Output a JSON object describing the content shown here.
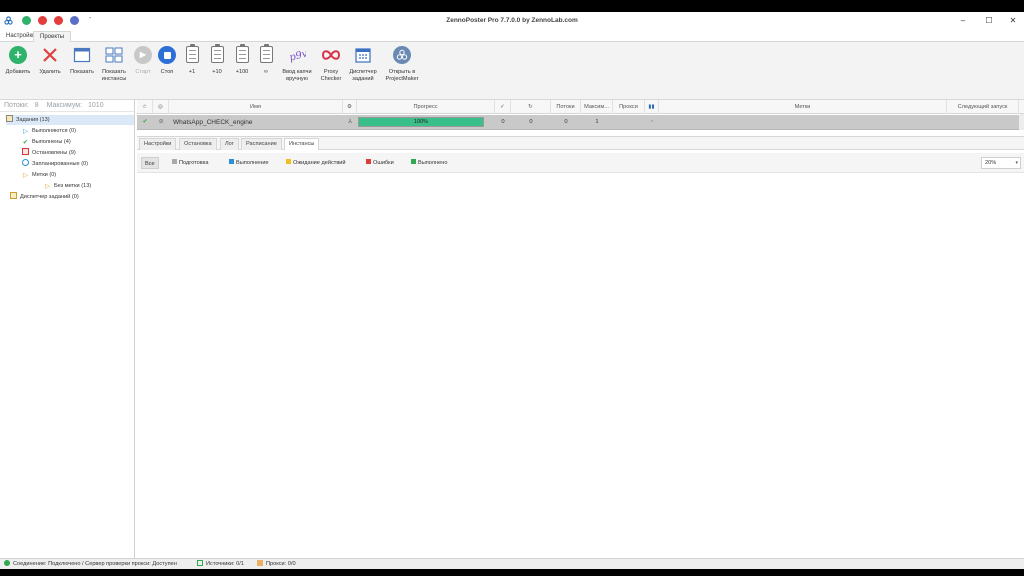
{
  "window": {
    "title": "ZennoPoster Pro 7.7.0.0 by ZennoLab.com",
    "qat_more": "-",
    "minimize": "–",
    "maximize": "☐",
    "close": "✕"
  },
  "menu": {
    "tabs": [
      "Настройки",
      "Проекты"
    ]
  },
  "ribbon": {
    "add": "Добавить",
    "delete": "Удалить",
    "show": "Показать",
    "show_instances": "Показать\nинстансы",
    "start": "Старт",
    "stop": "Стоп",
    "plus1": "+1",
    "plus10": "+10",
    "plus100": "+100",
    "infinite": "∞",
    "captcha": "Ввод капчи\nвручную",
    "proxy_checker": "Proxy\nChecker",
    "scheduler": "Диспетчер\nзаданий",
    "open_pm": "Открыть в\nProjectMaker"
  },
  "left_panel": {
    "threads_label": "Потоки:",
    "threads_value": "8",
    "max_label": "Максимум:",
    "max_value": "1010",
    "tree": {
      "tasks": "Задания (13)",
      "running": "Выполняются (0)",
      "completed": "Выполнены (4)",
      "stopped": "Остановлены (9)",
      "scheduled": "Запланированные (0)",
      "tags": "Метки (0)",
      "no_tags": "Без метки (13)",
      "task_manager": "Диспетчер заданий (0)"
    }
  },
  "grid": {
    "columns": {
      "name": "Имя",
      "progress": "Прогресс",
      "threads": "Потоки",
      "max": "Максим...",
      "proxies": "Прокси",
      "tags": "Метки",
      "next_run": "Следующий запуск"
    },
    "row": {
      "name": "WhatsApp_CHECK_engine",
      "progress": 1.0,
      "progress_text": "100%",
      "done": "0",
      "repeats": "0",
      "threads": "0",
      "max": "1"
    }
  },
  "bottom_tabs": [
    "Настройки",
    "Остановка",
    "Лог",
    "Расписание",
    "Инстансы"
  ],
  "filters": {
    "all": "Все",
    "preparing": "Подготовка",
    "running": "Выполнение",
    "waiting": "Ожидание действий",
    "errors": "Ошибки",
    "done": "Выполнено",
    "zoom": "20%"
  },
  "colors": {
    "accent_green": "#3bbf8a",
    "running": "#2a8fd6",
    "waiting": "#f0c020",
    "errors": "#e03b3b",
    "done": "#2fa84f"
  },
  "status": {
    "connection": "Соединение: Подключено / Сервер проверки прокси: Доступен",
    "sources": "Источники: 0/1",
    "proxies": "Прокси: 0/0"
  }
}
